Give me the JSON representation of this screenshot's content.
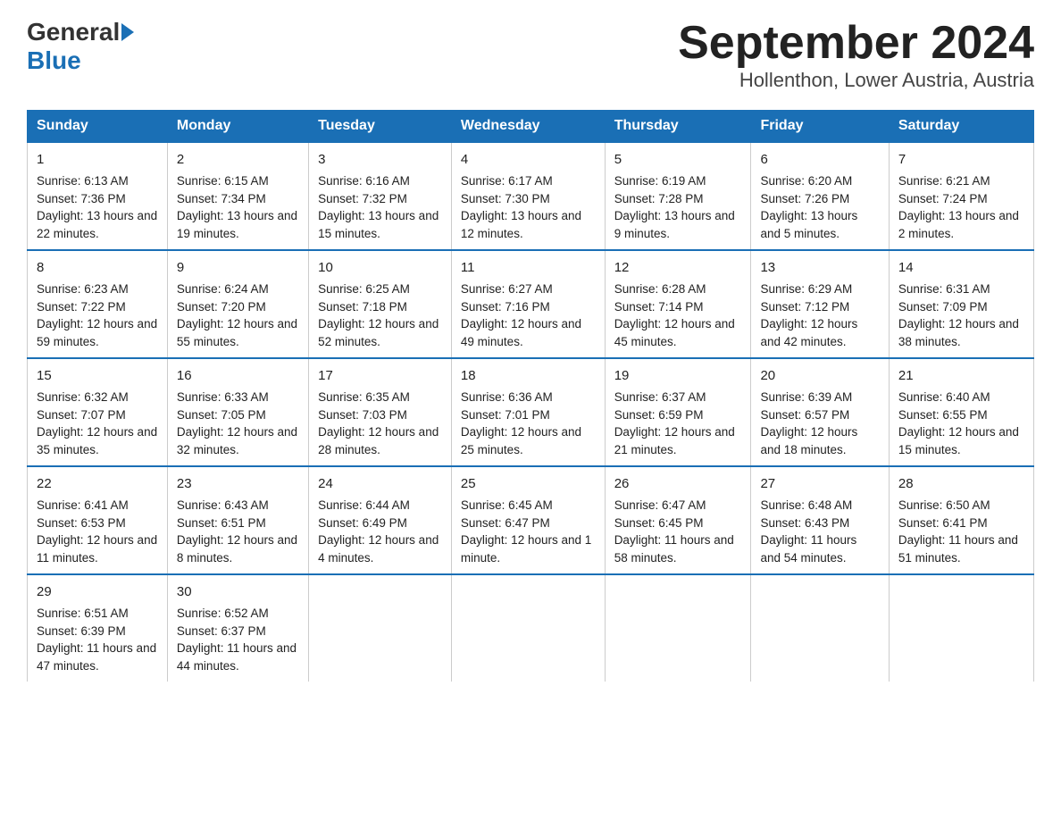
{
  "header": {
    "logo_general": "General",
    "logo_blue": "Blue",
    "title": "September 2024",
    "subtitle": "Hollenthon, Lower Austria, Austria"
  },
  "days_of_week": [
    "Sunday",
    "Monday",
    "Tuesday",
    "Wednesday",
    "Thursday",
    "Friday",
    "Saturday"
  ],
  "weeks": [
    [
      {
        "day": "1",
        "sunrise": "6:13 AM",
        "sunset": "7:36 PM",
        "daylight": "13 hours and 22 minutes."
      },
      {
        "day": "2",
        "sunrise": "6:15 AM",
        "sunset": "7:34 PM",
        "daylight": "13 hours and 19 minutes."
      },
      {
        "day": "3",
        "sunrise": "6:16 AM",
        "sunset": "7:32 PM",
        "daylight": "13 hours and 15 minutes."
      },
      {
        "day": "4",
        "sunrise": "6:17 AM",
        "sunset": "7:30 PM",
        "daylight": "13 hours and 12 minutes."
      },
      {
        "day": "5",
        "sunrise": "6:19 AM",
        "sunset": "7:28 PM",
        "daylight": "13 hours and 9 minutes."
      },
      {
        "day": "6",
        "sunrise": "6:20 AM",
        "sunset": "7:26 PM",
        "daylight": "13 hours and 5 minutes."
      },
      {
        "day": "7",
        "sunrise": "6:21 AM",
        "sunset": "7:24 PM",
        "daylight": "13 hours and 2 minutes."
      }
    ],
    [
      {
        "day": "8",
        "sunrise": "6:23 AM",
        "sunset": "7:22 PM",
        "daylight": "12 hours and 59 minutes."
      },
      {
        "day": "9",
        "sunrise": "6:24 AM",
        "sunset": "7:20 PM",
        "daylight": "12 hours and 55 minutes."
      },
      {
        "day": "10",
        "sunrise": "6:25 AM",
        "sunset": "7:18 PM",
        "daylight": "12 hours and 52 minutes."
      },
      {
        "day": "11",
        "sunrise": "6:27 AM",
        "sunset": "7:16 PM",
        "daylight": "12 hours and 49 minutes."
      },
      {
        "day": "12",
        "sunrise": "6:28 AM",
        "sunset": "7:14 PM",
        "daylight": "12 hours and 45 minutes."
      },
      {
        "day": "13",
        "sunrise": "6:29 AM",
        "sunset": "7:12 PM",
        "daylight": "12 hours and 42 minutes."
      },
      {
        "day": "14",
        "sunrise": "6:31 AM",
        "sunset": "7:09 PM",
        "daylight": "12 hours and 38 minutes."
      }
    ],
    [
      {
        "day": "15",
        "sunrise": "6:32 AM",
        "sunset": "7:07 PM",
        "daylight": "12 hours and 35 minutes."
      },
      {
        "day": "16",
        "sunrise": "6:33 AM",
        "sunset": "7:05 PM",
        "daylight": "12 hours and 32 minutes."
      },
      {
        "day": "17",
        "sunrise": "6:35 AM",
        "sunset": "7:03 PM",
        "daylight": "12 hours and 28 minutes."
      },
      {
        "day": "18",
        "sunrise": "6:36 AM",
        "sunset": "7:01 PM",
        "daylight": "12 hours and 25 minutes."
      },
      {
        "day": "19",
        "sunrise": "6:37 AM",
        "sunset": "6:59 PM",
        "daylight": "12 hours and 21 minutes."
      },
      {
        "day": "20",
        "sunrise": "6:39 AM",
        "sunset": "6:57 PM",
        "daylight": "12 hours and 18 minutes."
      },
      {
        "day": "21",
        "sunrise": "6:40 AM",
        "sunset": "6:55 PM",
        "daylight": "12 hours and 15 minutes."
      }
    ],
    [
      {
        "day": "22",
        "sunrise": "6:41 AM",
        "sunset": "6:53 PM",
        "daylight": "12 hours and 11 minutes."
      },
      {
        "day": "23",
        "sunrise": "6:43 AM",
        "sunset": "6:51 PM",
        "daylight": "12 hours and 8 minutes."
      },
      {
        "day": "24",
        "sunrise": "6:44 AM",
        "sunset": "6:49 PM",
        "daylight": "12 hours and 4 minutes."
      },
      {
        "day": "25",
        "sunrise": "6:45 AM",
        "sunset": "6:47 PM",
        "daylight": "12 hours and 1 minute."
      },
      {
        "day": "26",
        "sunrise": "6:47 AM",
        "sunset": "6:45 PM",
        "daylight": "11 hours and 58 minutes."
      },
      {
        "day": "27",
        "sunrise": "6:48 AM",
        "sunset": "6:43 PM",
        "daylight": "11 hours and 54 minutes."
      },
      {
        "day": "28",
        "sunrise": "6:50 AM",
        "sunset": "6:41 PM",
        "daylight": "11 hours and 51 minutes."
      }
    ],
    [
      {
        "day": "29",
        "sunrise": "6:51 AM",
        "sunset": "6:39 PM",
        "daylight": "11 hours and 47 minutes."
      },
      {
        "day": "30",
        "sunrise": "6:52 AM",
        "sunset": "6:37 PM",
        "daylight": "11 hours and 44 minutes."
      },
      null,
      null,
      null,
      null,
      null
    ]
  ]
}
